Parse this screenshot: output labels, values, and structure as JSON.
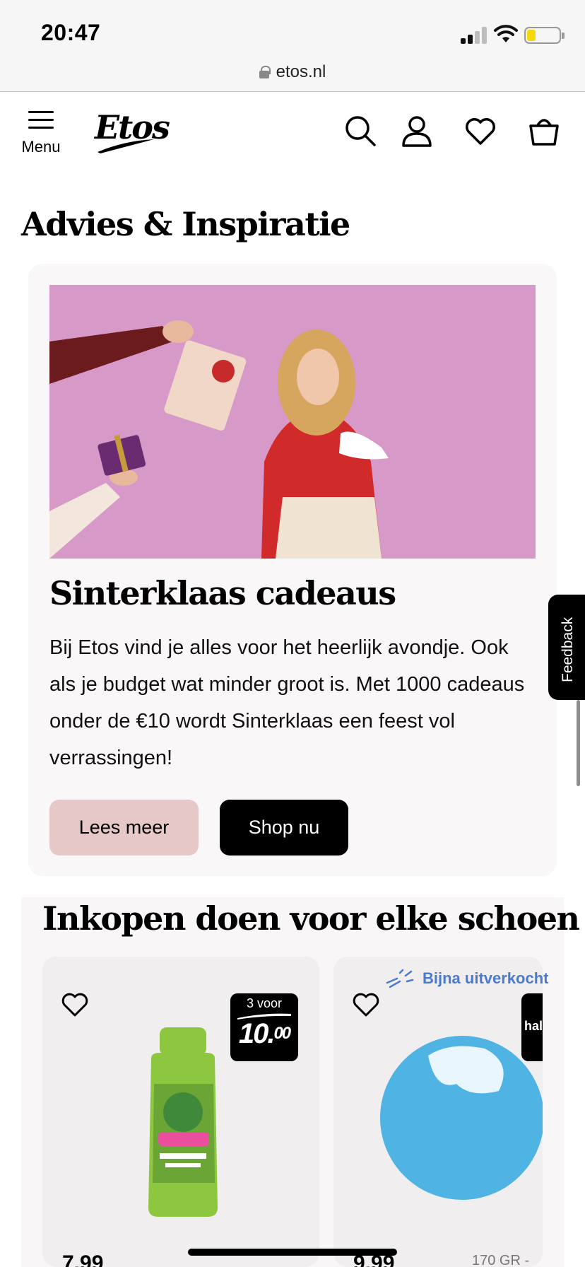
{
  "status_bar": {
    "time": "20:47",
    "battery_level": 0.2
  },
  "browser": {
    "url": "etos.nl"
  },
  "header": {
    "menu_label": "Menu",
    "logo_text": "Etos",
    "icons": [
      "search-icon",
      "account-icon",
      "heart-icon",
      "basket-icon"
    ]
  },
  "advice": {
    "title": "Advies & Inspiratie",
    "card": {
      "title": "Sinterklaas cadeaus",
      "body": "Bij Etos vind je alles voor het heerlijk avondje. Ook als je budget wat minder groot is. Met 1000 cadeaus onder de €10 wordt Sinterklaas een feest vol verrassingen!",
      "read_more": "Lees meer",
      "shop_now": "Shop nu",
      "hero_color": "#d79ac8"
    }
  },
  "feedback": {
    "label": "Feedback"
  },
  "shopping": {
    "title": "Inkopen doen voor elke schoen",
    "products": [
      {
        "promo_top": "3 voor",
        "promo_price_main": "10.",
        "promo_price_cents": "00",
        "price_peek": "7.99"
      },
      {
        "status": "Bijna uitverkocht",
        "promo_top": "hal",
        "price_peek": "9.99",
        "weight": "170 GR -"
      }
    ]
  },
  "colors": {
    "accent": "#4a7bd0",
    "button_secondary": "#e6c8c9",
    "button_primary": "#000000"
  }
}
